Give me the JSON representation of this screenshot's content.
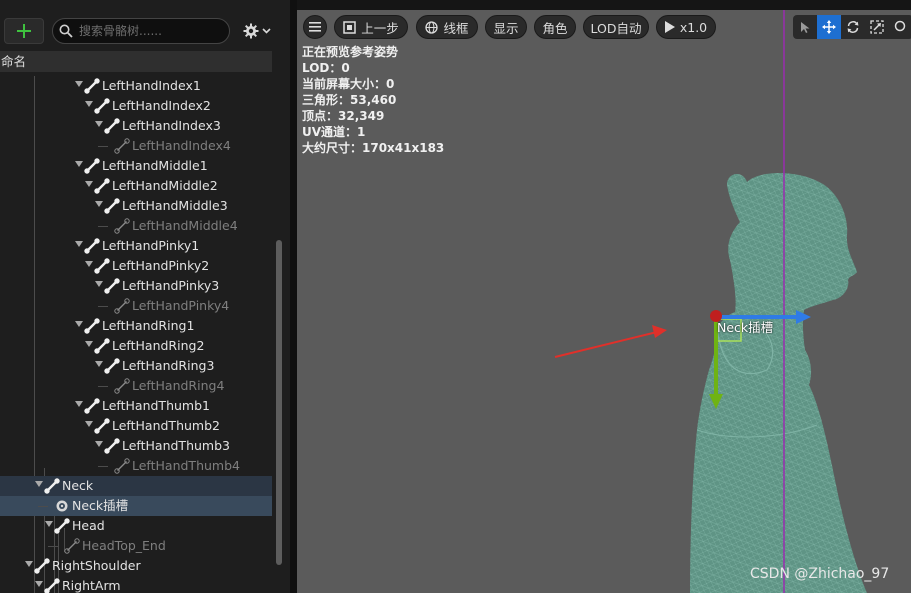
{
  "left_panel": {
    "search_placeholder": "搜索骨骼树......",
    "column_header": "命名",
    "tree": [
      {
        "label": "LeftHandIndex1",
        "depth": 0,
        "muted": false
      },
      {
        "label": "LeftHandIndex2",
        "depth": 1,
        "muted": false
      },
      {
        "label": "LeftHandIndex3",
        "depth": 2,
        "muted": false
      },
      {
        "label": "LeftHandIndex4",
        "depth": 3,
        "muted": true
      },
      {
        "label": "LeftHandMiddle1",
        "depth": 0,
        "muted": false
      },
      {
        "label": "LeftHandMiddle2",
        "depth": 1,
        "muted": false
      },
      {
        "label": "LeftHandMiddle3",
        "depth": 2,
        "muted": false
      },
      {
        "label": "LeftHandMiddle4",
        "depth": 3,
        "muted": true
      },
      {
        "label": "LeftHandPinky1",
        "depth": 0,
        "muted": false
      },
      {
        "label": "LeftHandPinky2",
        "depth": 1,
        "muted": false
      },
      {
        "label": "LeftHandPinky3",
        "depth": 2,
        "muted": false
      },
      {
        "label": "LeftHandPinky4",
        "depth": 3,
        "muted": true
      },
      {
        "label": "LeftHandRing1",
        "depth": 0,
        "muted": false
      },
      {
        "label": "LeftHandRing2",
        "depth": 1,
        "muted": false
      },
      {
        "label": "LeftHandRing3",
        "depth": 2,
        "muted": false
      },
      {
        "label": "LeftHandRing4",
        "depth": 3,
        "muted": true
      },
      {
        "label": "LeftHandThumb1",
        "depth": 0,
        "muted": false
      },
      {
        "label": "LeftHandThumb2",
        "depth": 1,
        "muted": false
      },
      {
        "label": "LeftHandThumb3",
        "depth": 2,
        "muted": false
      },
      {
        "label": "LeftHandThumb4",
        "depth": 3,
        "muted": true
      },
      {
        "label": "Neck",
        "depth": -4,
        "muted": false,
        "state": "hover"
      },
      {
        "label": "Neck插槽",
        "depth": -3,
        "muted": false,
        "state": "selected",
        "kind": "socket"
      },
      {
        "label": "Head",
        "depth": -3,
        "muted": false
      },
      {
        "label": "HeadTop_End",
        "depth": -2,
        "muted": true
      },
      {
        "label": "RightShoulder",
        "depth": -5,
        "muted": false
      },
      {
        "label": "RightArm",
        "depth": -4,
        "muted": false
      }
    ]
  },
  "toolbar": {
    "menu_icon": "hamburger-icon",
    "back_label": "上一步",
    "wireframe_label": "线框",
    "show_label": "显示",
    "character_label": "角色",
    "lod_label": "LOD自动",
    "play_speed_label": "x1.0"
  },
  "viewport_info": [
    "正在预览参考姿势",
    "LOD：0",
    "当前屏幕大小：0",
    "三角形：53,460",
    "顶点：32,349",
    "UV通道：1",
    "大约尺寸：170x41x183"
  ],
  "viewport": {
    "socket_label": "Neck插槽",
    "watermark": "CSDN @Zhichao_97",
    "colors": {
      "background": "#5b5b5b",
      "mesh": "#5f9485",
      "arrow": "#e0302a",
      "axis_x": "#2f7be6",
      "axis_z": "#6fb313",
      "axis_y": "#a9e05a",
      "center_line": "#9a2cb0",
      "selection": "#394a5c"
    }
  }
}
